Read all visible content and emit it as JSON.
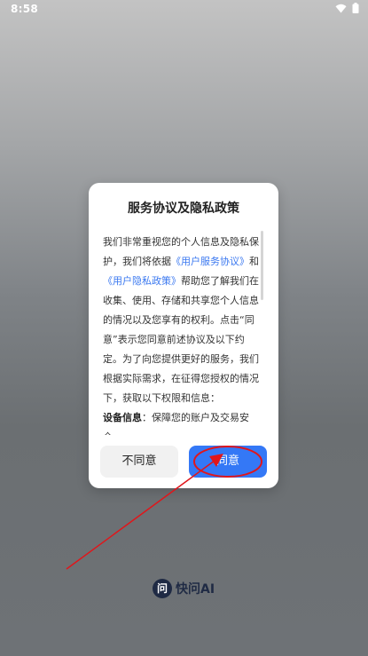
{
  "status_bar": {
    "time": "8:58"
  },
  "dialog": {
    "title": "服务协议及隐私政策",
    "body_text_1": "我们非常重视您的个人信息及隐私保护，我们将依据",
    "link_service": "《用户服务协议》",
    "body_text_2": "和",
    "link_privacy": "《用户隐私政策》",
    "body_text_3": "帮助您了解我们在收集、使用、存储和共享您个人信息的情况以及您享有的权利。点击“同意”表示您同意前述协议及以下约定。为了向您提供更好的服务，我们根据实际需求，在征得您授权的情况下，获取以下权限和信息：",
    "device_label": "设备信息",
    "device_text": "：保障您的账户及交易安全。",
    "disagree_label": "不同意",
    "agree_label": "同意"
  },
  "brand": {
    "logo_char": "问",
    "name": "快问AI"
  },
  "colors": {
    "accent": "#3478f6",
    "link": "#3a78f0",
    "annotation": "#e0161b"
  }
}
